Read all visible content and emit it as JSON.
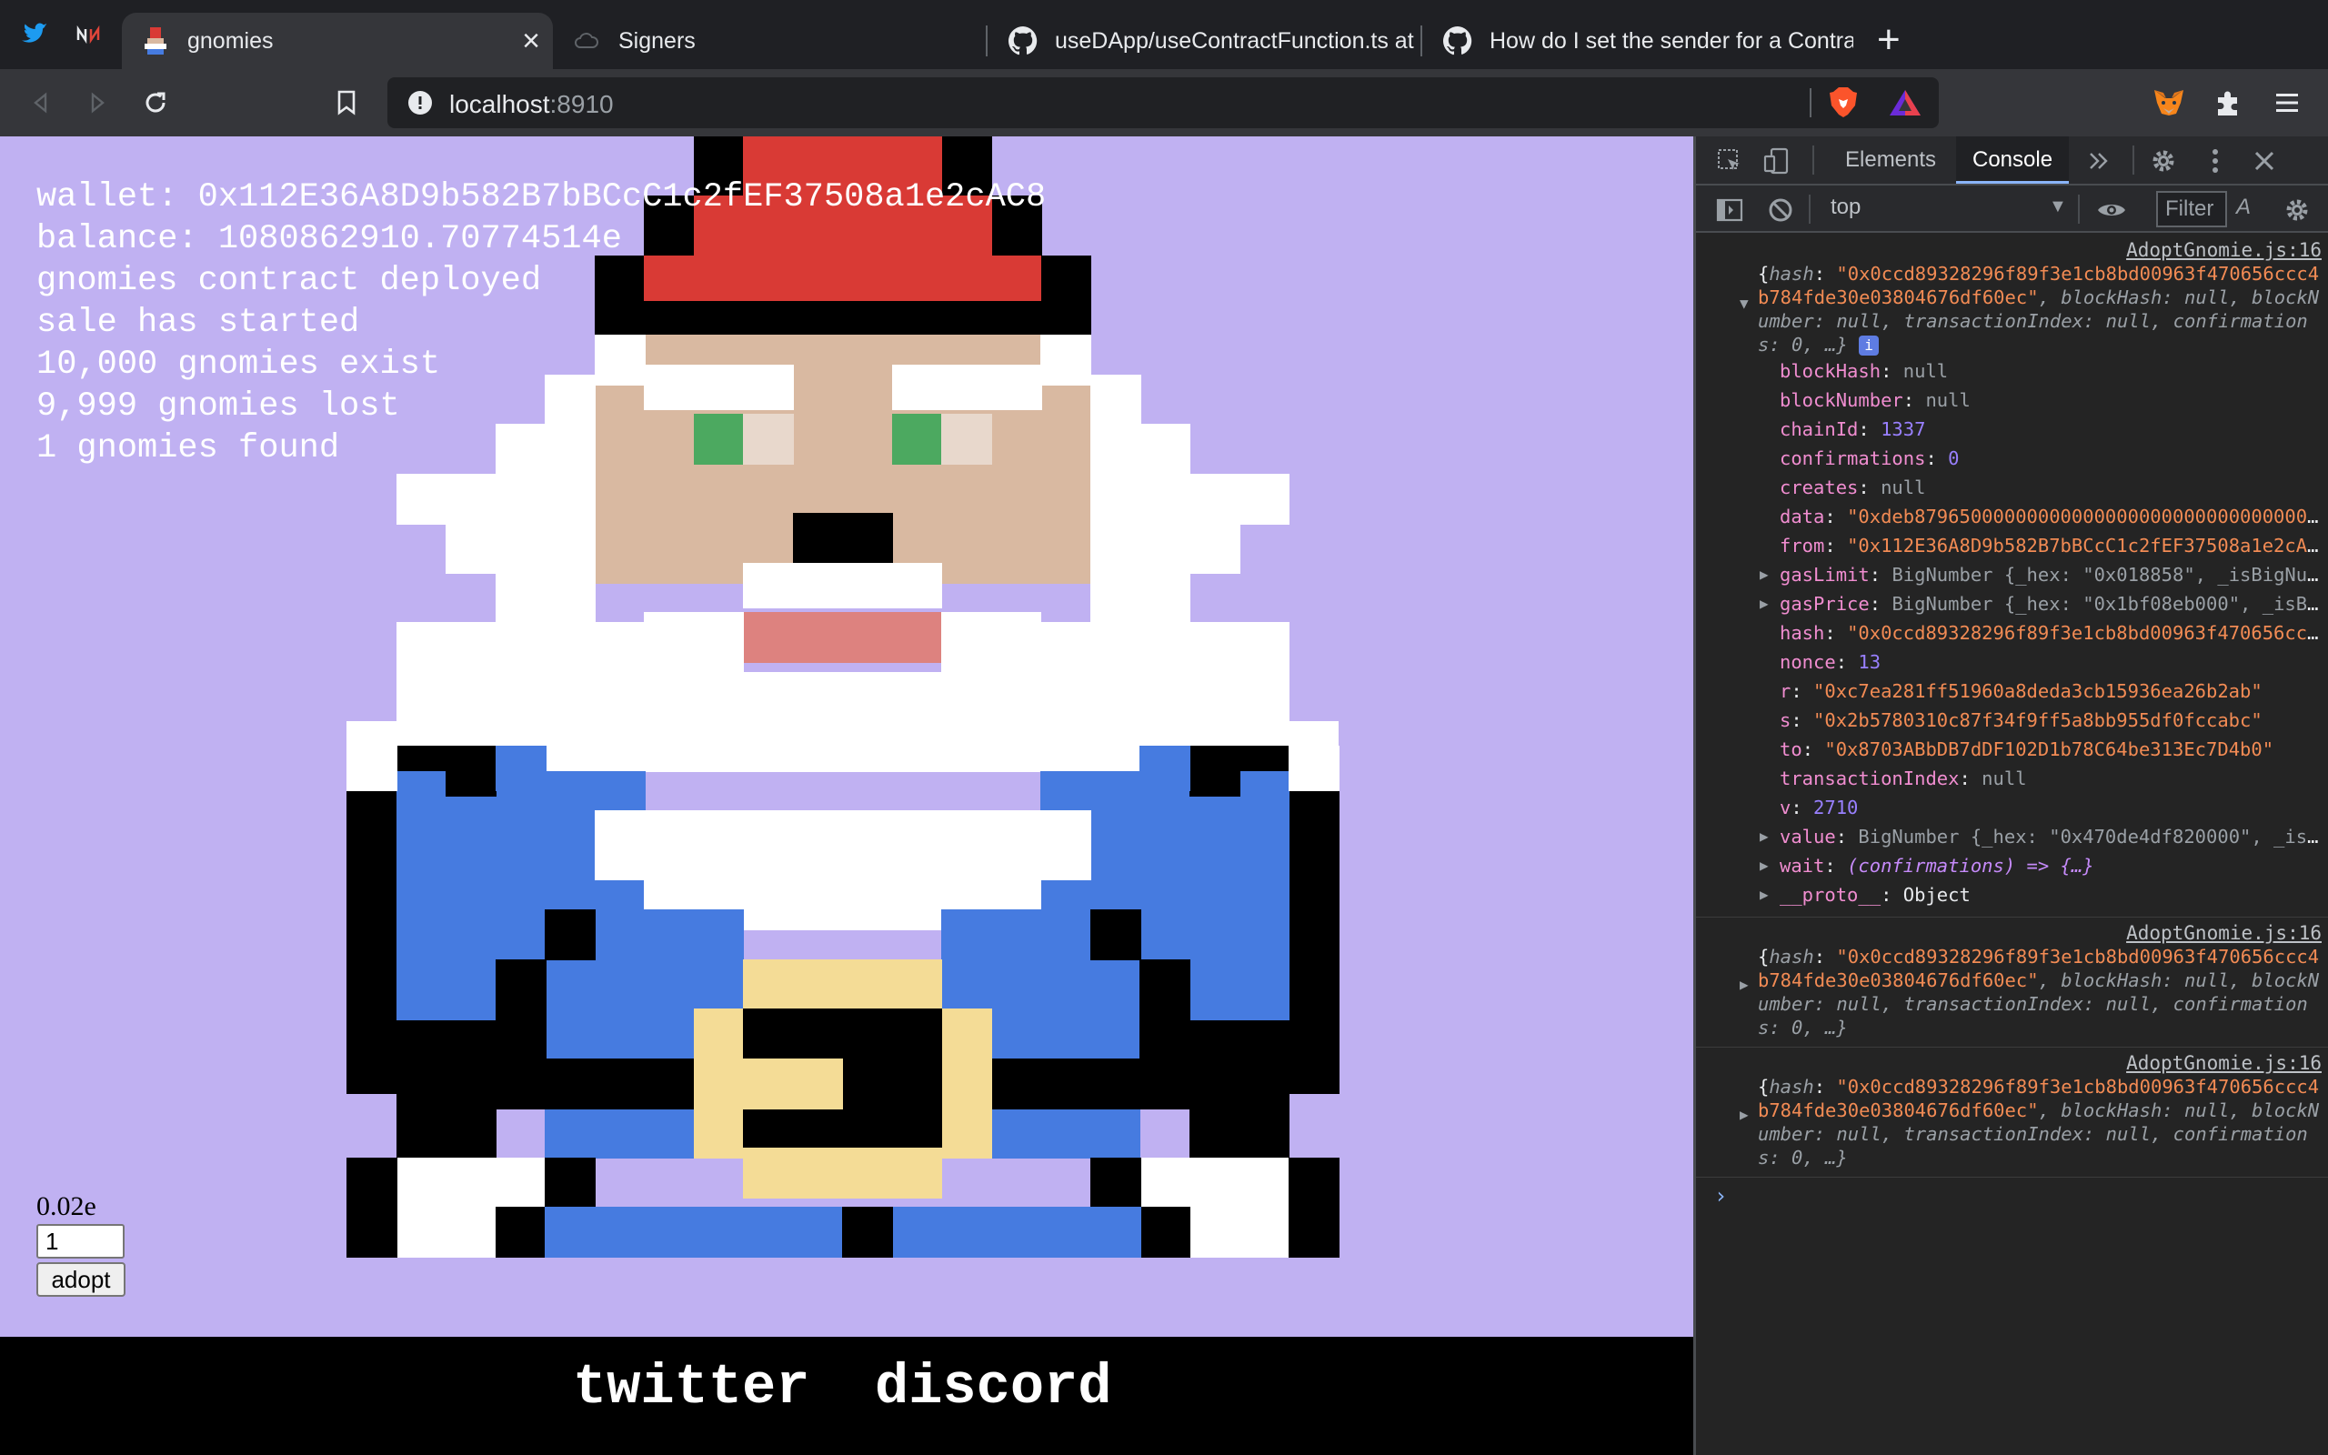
{
  "tabs": [
    {
      "title": "gnomies",
      "active": true
    },
    {
      "title": "Signers",
      "active": false
    },
    {
      "title": "useDApp/useContractFunction.ts at",
      "active": false
    },
    {
      "title": "How do I set the sender for a Contra",
      "active": false
    }
  ],
  "pinned_tabs": [
    "twitter-icon",
    "nomics-icon"
  ],
  "address_bar": {
    "host": "localhost",
    "port": ":8910"
  },
  "icons": {
    "back": "arrow-left-icon",
    "forward": "arrow-right-icon",
    "reload": "reload-icon",
    "bookmark": "bookmark-icon",
    "site_info": "info-circle-icon",
    "brave": "brave-lion-icon",
    "rewards": "brave-rewards-triangle-icon",
    "metamask": "metamask-fox-icon",
    "extensions": "puzzle-icon",
    "menu": "hamburger-menu-icon"
  },
  "page": {
    "info_lines": [
      "wallet: 0x112E36A8D9b582B7bBCcC1c2fEF37508a1e2cAC8",
      "balance: 1080862910.70774514e",
      "gnomies contract deployed",
      "sale has started",
      "10,000 gnomies exist",
      "9,999 gnomies lost",
      "1 gnomies found"
    ],
    "price": "0.02e",
    "quantity": "1",
    "adopt_label": "adopt",
    "footer_links": [
      "twitter",
      "discord"
    ],
    "colors": {
      "background": "#c0b1f2",
      "hat": "#d93a35",
      "skin": "#d9b9a1",
      "beard": "#ffffff",
      "eye": "#4ca960",
      "mouth": "#dd827f",
      "coat": "#467be0",
      "buckle": "#f4dc96",
      "outline": "#000000"
    }
  },
  "devtools": {
    "tabs": [
      "Elements",
      "Console"
    ],
    "active_tab": "Console",
    "context": "top",
    "filter_placeholder": "Filter",
    "source": "AdoptGnomie.js:16",
    "summary": {
      "hash": "\"0x0ccd89328296f89f3e1cb8bd00963f470656ccc4b784fde30e03804676df60ec\"",
      "rest": ", blockHash: null, blockNumber: null, transactionIndex: null, confirmations: 0, …}"
    },
    "properties": [
      {
        "key": "blockHash",
        "value": "null",
        "kind": "nul"
      },
      {
        "key": "blockNumber",
        "value": "null",
        "kind": "nul"
      },
      {
        "key": "chainId",
        "value": "1337",
        "kind": "num"
      },
      {
        "key": "confirmations",
        "value": "0",
        "kind": "num"
      },
      {
        "key": "creates",
        "value": "null",
        "kind": "nul"
      },
      {
        "key": "data",
        "value": "\"0xdeb8796500000000000000000000000000000000000000\"",
        "kind": "str"
      },
      {
        "key": "from",
        "value": "\"0x112E36A8D9b582B7bBCcC1c2fEF37508a1e2cAC8\"",
        "kind": "str"
      },
      {
        "key": "gasLimit",
        "value": "BigNumber {_hex: \"0x018858\", _isBigNumber: true}",
        "kind": "obj",
        "expandable": true
      },
      {
        "key": "gasPrice",
        "value": "BigNumber {_hex: \"0x1bf08eb000\", _isBigNumber: true}",
        "kind": "obj",
        "expandable": true
      },
      {
        "key": "hash",
        "value": "\"0x0ccd89328296f89f3e1cb8bd00963f470656ccc4b784\"",
        "kind": "str"
      },
      {
        "key": "nonce",
        "value": "13",
        "kind": "num"
      },
      {
        "key": "r",
        "value": "\"0xc7ea281ff51960a8deda3cb15936ea26b2ab\"",
        "kind": "str"
      },
      {
        "key": "s",
        "value": "\"0x2b5780310c87f34f9ff5a8bb955df0fccabc\"",
        "kind": "str"
      },
      {
        "key": "to",
        "value": "\"0x8703ABbDB7dDF102D1b78C64be313Ec7D4b0\"",
        "kind": "str"
      },
      {
        "key": "transactionIndex",
        "value": "null",
        "kind": "nul"
      },
      {
        "key": "v",
        "value": "2710",
        "kind": "num"
      },
      {
        "key": "value",
        "value": "BigNumber {_hex: \"0x470de4df820000\", _isBigNumber: true}",
        "kind": "obj",
        "expandable": true
      },
      {
        "key": "wait",
        "value": "(confirmations) => {…}",
        "kind": "fn",
        "expandable": true
      },
      {
        "key": "__proto__",
        "value": "Object",
        "kind": "plain",
        "expandable": true
      }
    ]
  }
}
